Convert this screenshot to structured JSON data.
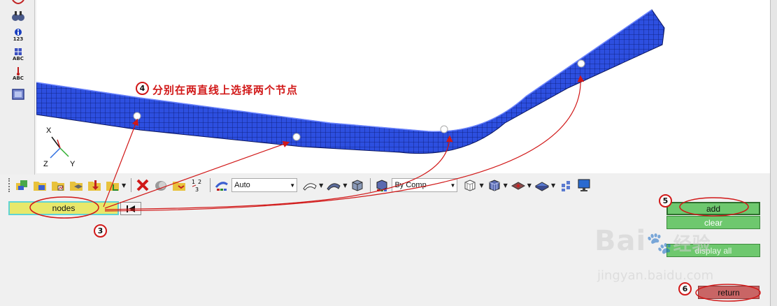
{
  "panel": {
    "selector_label": "nodes",
    "add_label": "add",
    "clear_label": "clear",
    "display_all_label": "display all",
    "return_label": "return"
  },
  "toolbar": {
    "mesh_mode": "Auto",
    "color_mode": "By Comp"
  },
  "left_tools": {
    "numbers_label": "123",
    "abc1_label": "ABC",
    "abc2_label": "ABC"
  },
  "triad": {
    "x": "X",
    "y": "Y",
    "z": "Z"
  },
  "annotations": {
    "note": "分别在两直线上选择两个节点",
    "step3": "3",
    "step4": "4",
    "step5": "5",
    "step6": "6"
  },
  "watermark": {
    "logo": "Bai",
    "logo2": "经验",
    "url": "jingyan.baidu.com"
  },
  "colors": {
    "mesh_blue": "#2d4fe0",
    "selector_yellow": "#e8e86a",
    "panel_green": "#6ec86e",
    "return_red": "#c96565",
    "annotation_red": "#d11818"
  }
}
